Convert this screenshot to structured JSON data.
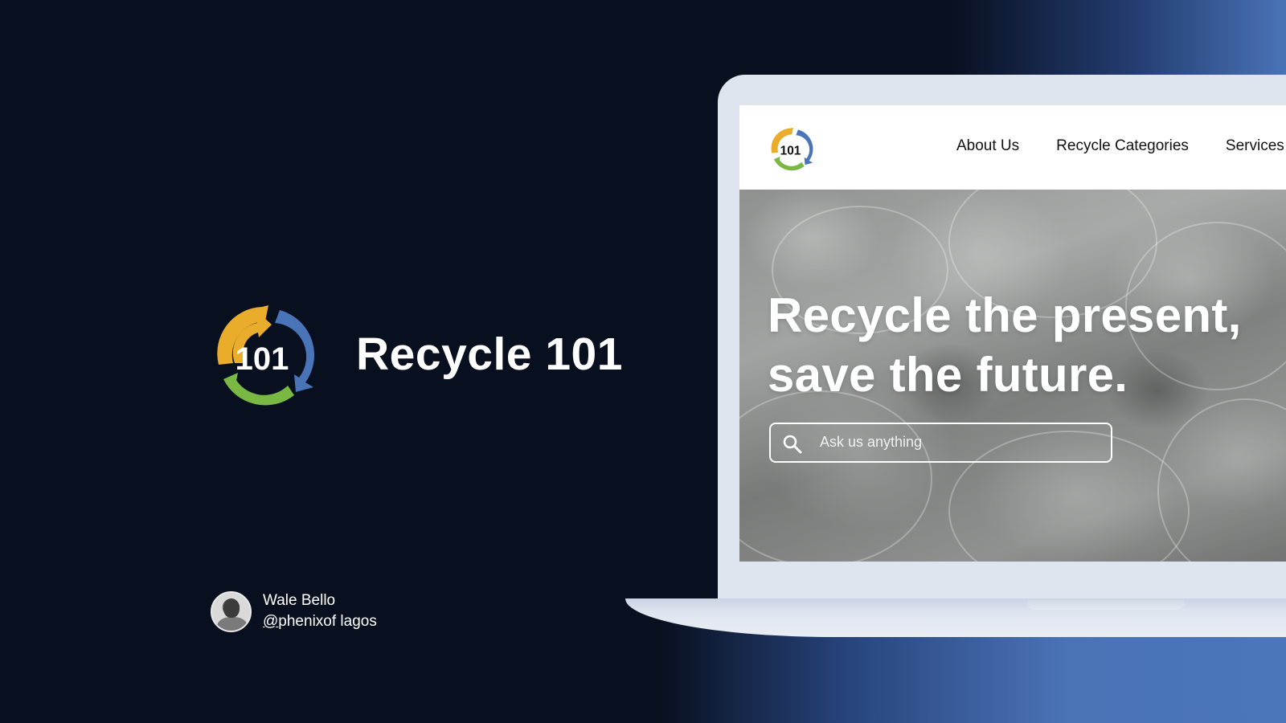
{
  "brand": {
    "name": "Recycle 101",
    "logo_text": "101"
  },
  "author": {
    "name": "Wale Bello",
    "handle_at": "@",
    "handle_rest": "phenixof lagos"
  },
  "site": {
    "logo_text": "101",
    "nav": [
      {
        "label": "About Us"
      },
      {
        "label": "Recycle Categories"
      },
      {
        "label": "Services"
      }
    ],
    "hero": {
      "title_line1": "Recycle the present,",
      "title_line2": "save the future."
    },
    "search": {
      "placeholder": "Ask us anything"
    }
  },
  "colors": {
    "background": "#080f1f",
    "accent_blue": "#4a73b6",
    "logo_yellow": "#e9ac2b",
    "logo_blue": "#4a74b8",
    "logo_green": "#7ab844"
  },
  "icons": {
    "search": "search-icon",
    "logo": "recycle-logo-icon"
  }
}
